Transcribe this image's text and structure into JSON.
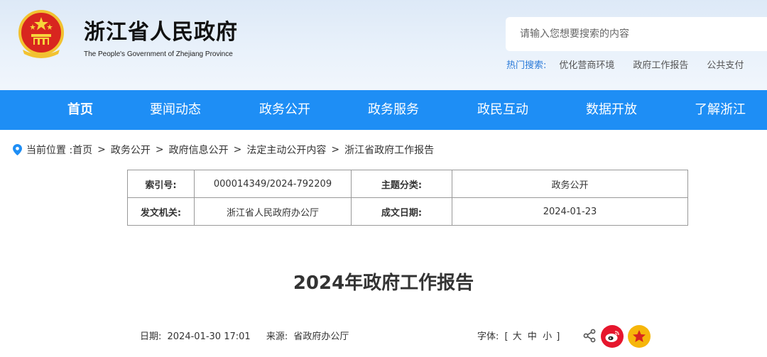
{
  "header": {
    "title": "浙江省人民政府",
    "subtitle": "The People's Government of Zhejiang Province",
    "search_placeholder": "请输入您想要搜索的内容",
    "hot_label": "热门搜索:",
    "hot_items": [
      "优化营商环境",
      "政府工作报告",
      "公共支付"
    ]
  },
  "nav": {
    "items": [
      "首页",
      "要闻动态",
      "政务公开",
      "政务服务",
      "政民互动",
      "数据开放",
      "了解浙江"
    ],
    "active": "首页"
  },
  "breadcrumb": {
    "prefix": "当前位置 :",
    "items": [
      "首页",
      "政务公开",
      "政府信息公开",
      "法定主动公开内容",
      "浙江省政府工作报告"
    ],
    "separator": ">"
  },
  "info": {
    "index_label": "索引号:",
    "index_value": "000014349/2024-792209",
    "topic_label": "主题分类:",
    "topic_value": "政务公开",
    "issuer_label": "发文机关:",
    "issuer_value": "浙江省人民政府办公厅",
    "date_label": "成文日期:",
    "date_value": "2024-01-23"
  },
  "article": {
    "title": "2024年政府工作报告",
    "date_label": "日期:",
    "date_value": "2024-01-30 17:01",
    "source_label": "来源:",
    "source_value": "省政府办公厅",
    "font_label": "字体:",
    "font_open": "[",
    "font_large": "大",
    "font_medium": "中",
    "font_small": "小",
    "font_close": "]"
  },
  "colors": {
    "nav_bg": "#1e8ef5",
    "hot_label": "#2a7ad8",
    "weibo": "#e6162d",
    "star": "#f6b60a"
  }
}
